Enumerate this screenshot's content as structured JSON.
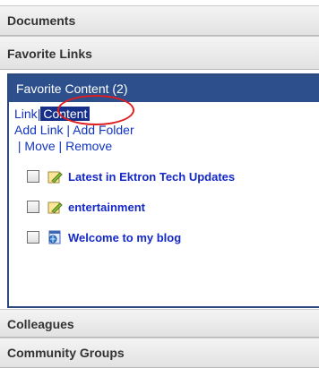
{
  "accordion": {
    "documents_label": "Documents",
    "favorite_links_label": "Favorite Links",
    "colleagues_label": "Colleagues",
    "community_groups_label": "Community Groups"
  },
  "favorite_panel": {
    "title": "Favorite Content (2)",
    "tabs": {
      "link": "Link",
      "content": "Content"
    },
    "separator": "|",
    "actions": {
      "add_link": "Add Link",
      "add_folder": "Add Folder",
      "move": "Move",
      "remove": "Remove"
    },
    "items": [
      {
        "label": "Latest in Ektron Tech Updates",
        "icon": "edit-pencil-icon"
      },
      {
        "label": "entertainment",
        "icon": "edit-pencil-icon"
      },
      {
        "label": "Welcome to my blog",
        "icon": "web-page-icon"
      }
    ]
  },
  "colors": {
    "panel_header": "#2d4f8c",
    "link": "#1235c0",
    "highlight_ring": "#e01d1d",
    "active_tab": "#16308a"
  }
}
